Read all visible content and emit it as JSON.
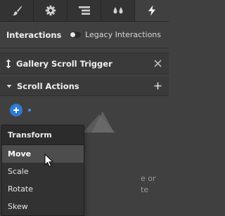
{
  "tabs": [
    {
      "icon": "paintbrush-icon",
      "active": false
    },
    {
      "icon": "gear-icon",
      "active": false
    },
    {
      "icon": "navigator-icon",
      "active": false
    },
    {
      "icon": "drops-icon",
      "active": false
    },
    {
      "icon": "lightning-icon",
      "active": true
    }
  ],
  "interactions": {
    "title": "Interactions",
    "legacy_label": "Legacy Interactions",
    "legacy_enabled": false
  },
  "trigger": {
    "title": "Gallery Scroll Trigger"
  },
  "scroll_actions": {
    "title": "Scroll Actions"
  },
  "hint_text": "e or\nte",
  "dropdown": {
    "header": "Transform",
    "items": [
      "Move",
      "Scale",
      "Rotate",
      "Skew"
    ],
    "hovered": "Move"
  },
  "colors": {
    "background": "#404040",
    "accent_blue": "#2f7bd6",
    "dropdown_bg": "#323232",
    "hover_bg": "#4d4d4d"
  }
}
